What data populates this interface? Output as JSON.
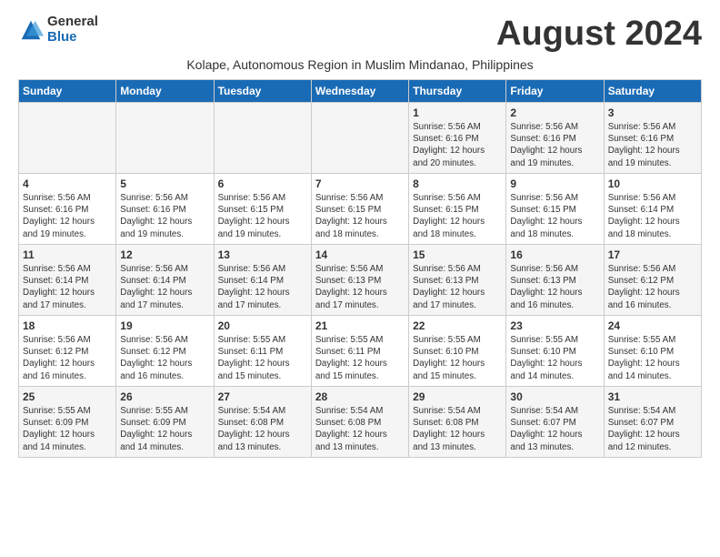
{
  "logo": {
    "general": "General",
    "blue": "Blue"
  },
  "title": "August 2024",
  "subtitle": "Kolape, Autonomous Region in Muslim Mindanao, Philippines",
  "days_header": [
    "Sunday",
    "Monday",
    "Tuesday",
    "Wednesday",
    "Thursday",
    "Friday",
    "Saturday"
  ],
  "weeks": [
    [
      {
        "day": "",
        "info": ""
      },
      {
        "day": "",
        "info": ""
      },
      {
        "day": "",
        "info": ""
      },
      {
        "day": "",
        "info": ""
      },
      {
        "day": "1",
        "info": "Sunrise: 5:56 AM\nSunset: 6:16 PM\nDaylight: 12 hours\nand 20 minutes."
      },
      {
        "day": "2",
        "info": "Sunrise: 5:56 AM\nSunset: 6:16 PM\nDaylight: 12 hours\nand 19 minutes."
      },
      {
        "day": "3",
        "info": "Sunrise: 5:56 AM\nSunset: 6:16 PM\nDaylight: 12 hours\nand 19 minutes."
      }
    ],
    [
      {
        "day": "4",
        "info": "Sunrise: 5:56 AM\nSunset: 6:16 PM\nDaylight: 12 hours\nand 19 minutes."
      },
      {
        "day": "5",
        "info": "Sunrise: 5:56 AM\nSunset: 6:16 PM\nDaylight: 12 hours\nand 19 minutes."
      },
      {
        "day": "6",
        "info": "Sunrise: 5:56 AM\nSunset: 6:15 PM\nDaylight: 12 hours\nand 19 minutes."
      },
      {
        "day": "7",
        "info": "Sunrise: 5:56 AM\nSunset: 6:15 PM\nDaylight: 12 hours\nand 18 minutes."
      },
      {
        "day": "8",
        "info": "Sunrise: 5:56 AM\nSunset: 6:15 PM\nDaylight: 12 hours\nand 18 minutes."
      },
      {
        "day": "9",
        "info": "Sunrise: 5:56 AM\nSunset: 6:15 PM\nDaylight: 12 hours\nand 18 minutes."
      },
      {
        "day": "10",
        "info": "Sunrise: 5:56 AM\nSunset: 6:14 PM\nDaylight: 12 hours\nand 18 minutes."
      }
    ],
    [
      {
        "day": "11",
        "info": "Sunrise: 5:56 AM\nSunset: 6:14 PM\nDaylight: 12 hours\nand 17 minutes."
      },
      {
        "day": "12",
        "info": "Sunrise: 5:56 AM\nSunset: 6:14 PM\nDaylight: 12 hours\nand 17 minutes."
      },
      {
        "day": "13",
        "info": "Sunrise: 5:56 AM\nSunset: 6:14 PM\nDaylight: 12 hours\nand 17 minutes."
      },
      {
        "day": "14",
        "info": "Sunrise: 5:56 AM\nSunset: 6:13 PM\nDaylight: 12 hours\nand 17 minutes."
      },
      {
        "day": "15",
        "info": "Sunrise: 5:56 AM\nSunset: 6:13 PM\nDaylight: 12 hours\nand 17 minutes."
      },
      {
        "day": "16",
        "info": "Sunrise: 5:56 AM\nSunset: 6:13 PM\nDaylight: 12 hours\nand 16 minutes."
      },
      {
        "day": "17",
        "info": "Sunrise: 5:56 AM\nSunset: 6:12 PM\nDaylight: 12 hours\nand 16 minutes."
      }
    ],
    [
      {
        "day": "18",
        "info": "Sunrise: 5:56 AM\nSunset: 6:12 PM\nDaylight: 12 hours\nand 16 minutes."
      },
      {
        "day": "19",
        "info": "Sunrise: 5:56 AM\nSunset: 6:12 PM\nDaylight: 12 hours\nand 16 minutes."
      },
      {
        "day": "20",
        "info": "Sunrise: 5:55 AM\nSunset: 6:11 PM\nDaylight: 12 hours\nand 15 minutes."
      },
      {
        "day": "21",
        "info": "Sunrise: 5:55 AM\nSunset: 6:11 PM\nDaylight: 12 hours\nand 15 minutes."
      },
      {
        "day": "22",
        "info": "Sunrise: 5:55 AM\nSunset: 6:10 PM\nDaylight: 12 hours\nand 15 minutes."
      },
      {
        "day": "23",
        "info": "Sunrise: 5:55 AM\nSunset: 6:10 PM\nDaylight: 12 hours\nand 14 minutes."
      },
      {
        "day": "24",
        "info": "Sunrise: 5:55 AM\nSunset: 6:10 PM\nDaylight: 12 hours\nand 14 minutes."
      }
    ],
    [
      {
        "day": "25",
        "info": "Sunrise: 5:55 AM\nSunset: 6:09 PM\nDaylight: 12 hours\nand 14 minutes."
      },
      {
        "day": "26",
        "info": "Sunrise: 5:55 AM\nSunset: 6:09 PM\nDaylight: 12 hours\nand 14 minutes."
      },
      {
        "day": "27",
        "info": "Sunrise: 5:54 AM\nSunset: 6:08 PM\nDaylight: 12 hours\nand 13 minutes."
      },
      {
        "day": "28",
        "info": "Sunrise: 5:54 AM\nSunset: 6:08 PM\nDaylight: 12 hours\nand 13 minutes."
      },
      {
        "day": "29",
        "info": "Sunrise: 5:54 AM\nSunset: 6:08 PM\nDaylight: 12 hours\nand 13 minutes."
      },
      {
        "day": "30",
        "info": "Sunrise: 5:54 AM\nSunset: 6:07 PM\nDaylight: 12 hours\nand 13 minutes."
      },
      {
        "day": "31",
        "info": "Sunrise: 5:54 AM\nSunset: 6:07 PM\nDaylight: 12 hours\nand 12 minutes."
      }
    ]
  ]
}
